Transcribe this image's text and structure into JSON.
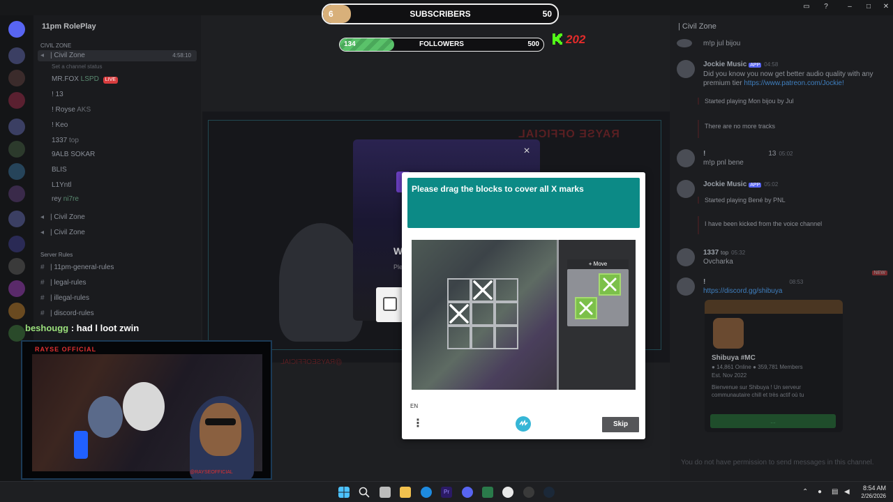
{
  "stream": {
    "subscribers": {
      "label": "SUBSCRIBERS",
      "current": "6",
      "goal": "50",
      "progress": 0.12
    },
    "followers": {
      "label": "FOLLOWERS",
      "current": "134",
      "goal": "500",
      "progress": 0.268
    },
    "kick_count": "202",
    "chat_message": {
      "user": "beshougg",
      "text": ": had l loot zwin"
    },
    "cam_header": "RAYSE OFFICIAL",
    "cam_footer": "@RAYSEOFFICIAL",
    "mirror_title": "RAYSE OFFICIAL",
    "mirror_handle": "@RAYSEOFFICIAL"
  },
  "discord": {
    "guild_name": "11pm RolePlay",
    "categories": {
      "civil": "CIVIL ZONE",
      "rules": "Server Rules"
    },
    "channels": [
      {
        "label": "| Civil Zone",
        "meta": "4:58:10"
      },
      {
        "label": "Set a channel status"
      },
      {
        "label": "MR.FOX",
        "tag": "LSPD",
        "badge": "LIVE"
      },
      {
        "label": "! 13"
      },
      {
        "label": "! Royse",
        "tag": "AKS"
      },
      {
        "label": "! Keo"
      },
      {
        "label": "1337",
        "tag": "top"
      },
      {
        "label": "9ALB SOKAR"
      },
      {
        "label": "BLIS"
      },
      {
        "label": "L1Yntl"
      },
      {
        "label": "rey",
        "tag": "ni7re"
      },
      {
        "label": "| Civil Zone"
      },
      {
        "label": "| Civil Zone"
      },
      {
        "label": "| 11pm-general-rules"
      },
      {
        "label": "| legal-rules"
      },
      {
        "label": "| illegal-rules"
      },
      {
        "label": "| discord-rules"
      }
    ],
    "chat_header": "| Civil Zone",
    "messages": [
      {
        "text": "m!p jul bijou"
      },
      {
        "name": "Jockie Music",
        "app": "APP",
        "time": "04:58",
        "text": "Did you know you now get better audio quality with any premium tier",
        "link": "https://www.patreon.com/Jockie!"
      },
      {
        "embed": "Started playing Mon bijou by Jul"
      },
      {
        "embed": "There are no more tracks"
      },
      {
        "name": "!",
        "tag": "13",
        "time": "05:02",
        "text": "m!p pnl bene"
      },
      {
        "name": "Jockie Music",
        "app": "APP",
        "time": "05:02"
      },
      {
        "embed": "Started playing Bené by PNL"
      },
      {
        "embed": "I have been kicked from the voice channel"
      },
      {
        "name": "1337",
        "tag": "top",
        "time": "05:32",
        "text": "Ovcharka"
      },
      {
        "name": "!",
        "time": "08:53",
        "link": "https://discord.gg/shibuya"
      }
    ],
    "new_badge": "NEW",
    "server_card": {
      "name": "Shibuya",
      "tag": "#MC",
      "online": "14,861 Online",
      "members": "359,781 Members",
      "est": "Est. Nov 2022",
      "desc": "Bienvenue sur Shibuya ! Un serveur communautaire chill et très actif où tu",
      "button": "..."
    },
    "no_permission": "You do not have permission to send messages in this channel."
  },
  "bg_modal": {
    "letter_w": "W",
    "letter_ple": "Ple",
    "close": "×"
  },
  "captcha": {
    "prompt": "Please drag the blocks to cover all X marks",
    "move_label": "Move",
    "lang": "EN",
    "menu": "⋮",
    "skip": "Skip"
  },
  "taskbar": {
    "time": "8:54 AM",
    "date": "2/26/2026"
  },
  "colors": {
    "teal": "#0c8a86",
    "block_green": "#7cc04a",
    "kick_red": "#e32b2b",
    "sub_gold": "#d8b07a",
    "follow_green": "#5ac26a"
  }
}
